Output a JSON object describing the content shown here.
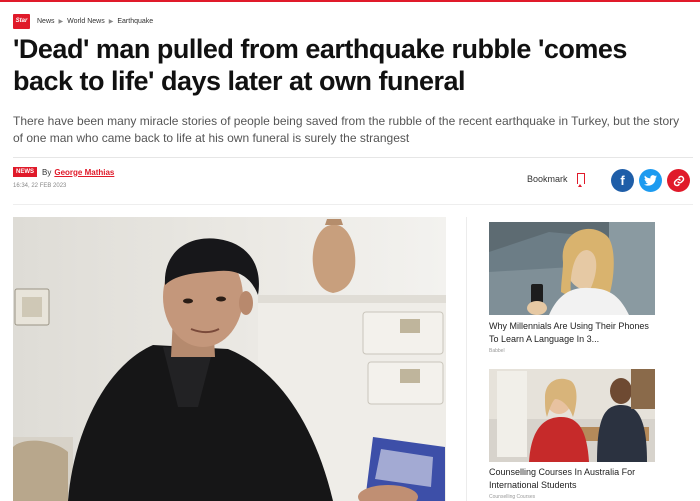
{
  "site": {
    "logo_text": "Star"
  },
  "breadcrumb": [
    "News",
    "World News",
    "Earthquake"
  ],
  "article": {
    "headline": "'Dead' man pulled from earthquake rubble 'comes back to life' days later at own funeral",
    "standfirst_line1": "There have been many miracle stories of people being saved from the rubble of the recent earthquake in Turkey, but the story",
    "standfirst_line2": "of one man who came back to life at his own funeral is surely the strangest",
    "badge": "NEWS",
    "by": "By",
    "author": "George Mathias",
    "date": "16:34, 22 FEB 2023",
    "bookmark_label": "Bookmark"
  },
  "share": {
    "facebook": "f",
    "twitter": "t",
    "link": "🔗"
  },
  "sidebar": {
    "cards": [
      {
        "title": "Why Millennials Are Using Their Phones To Learn A Language In 3...",
        "sponsor": "Babbel"
      },
      {
        "title": "Counselling Courses In Australia For International Students",
        "sponsor": "Counselling Courses"
      }
    ]
  },
  "colors": {
    "accent": "#e01a2a",
    "facebook": "#1f5ea8",
    "twitter": "#1d9bf0"
  }
}
